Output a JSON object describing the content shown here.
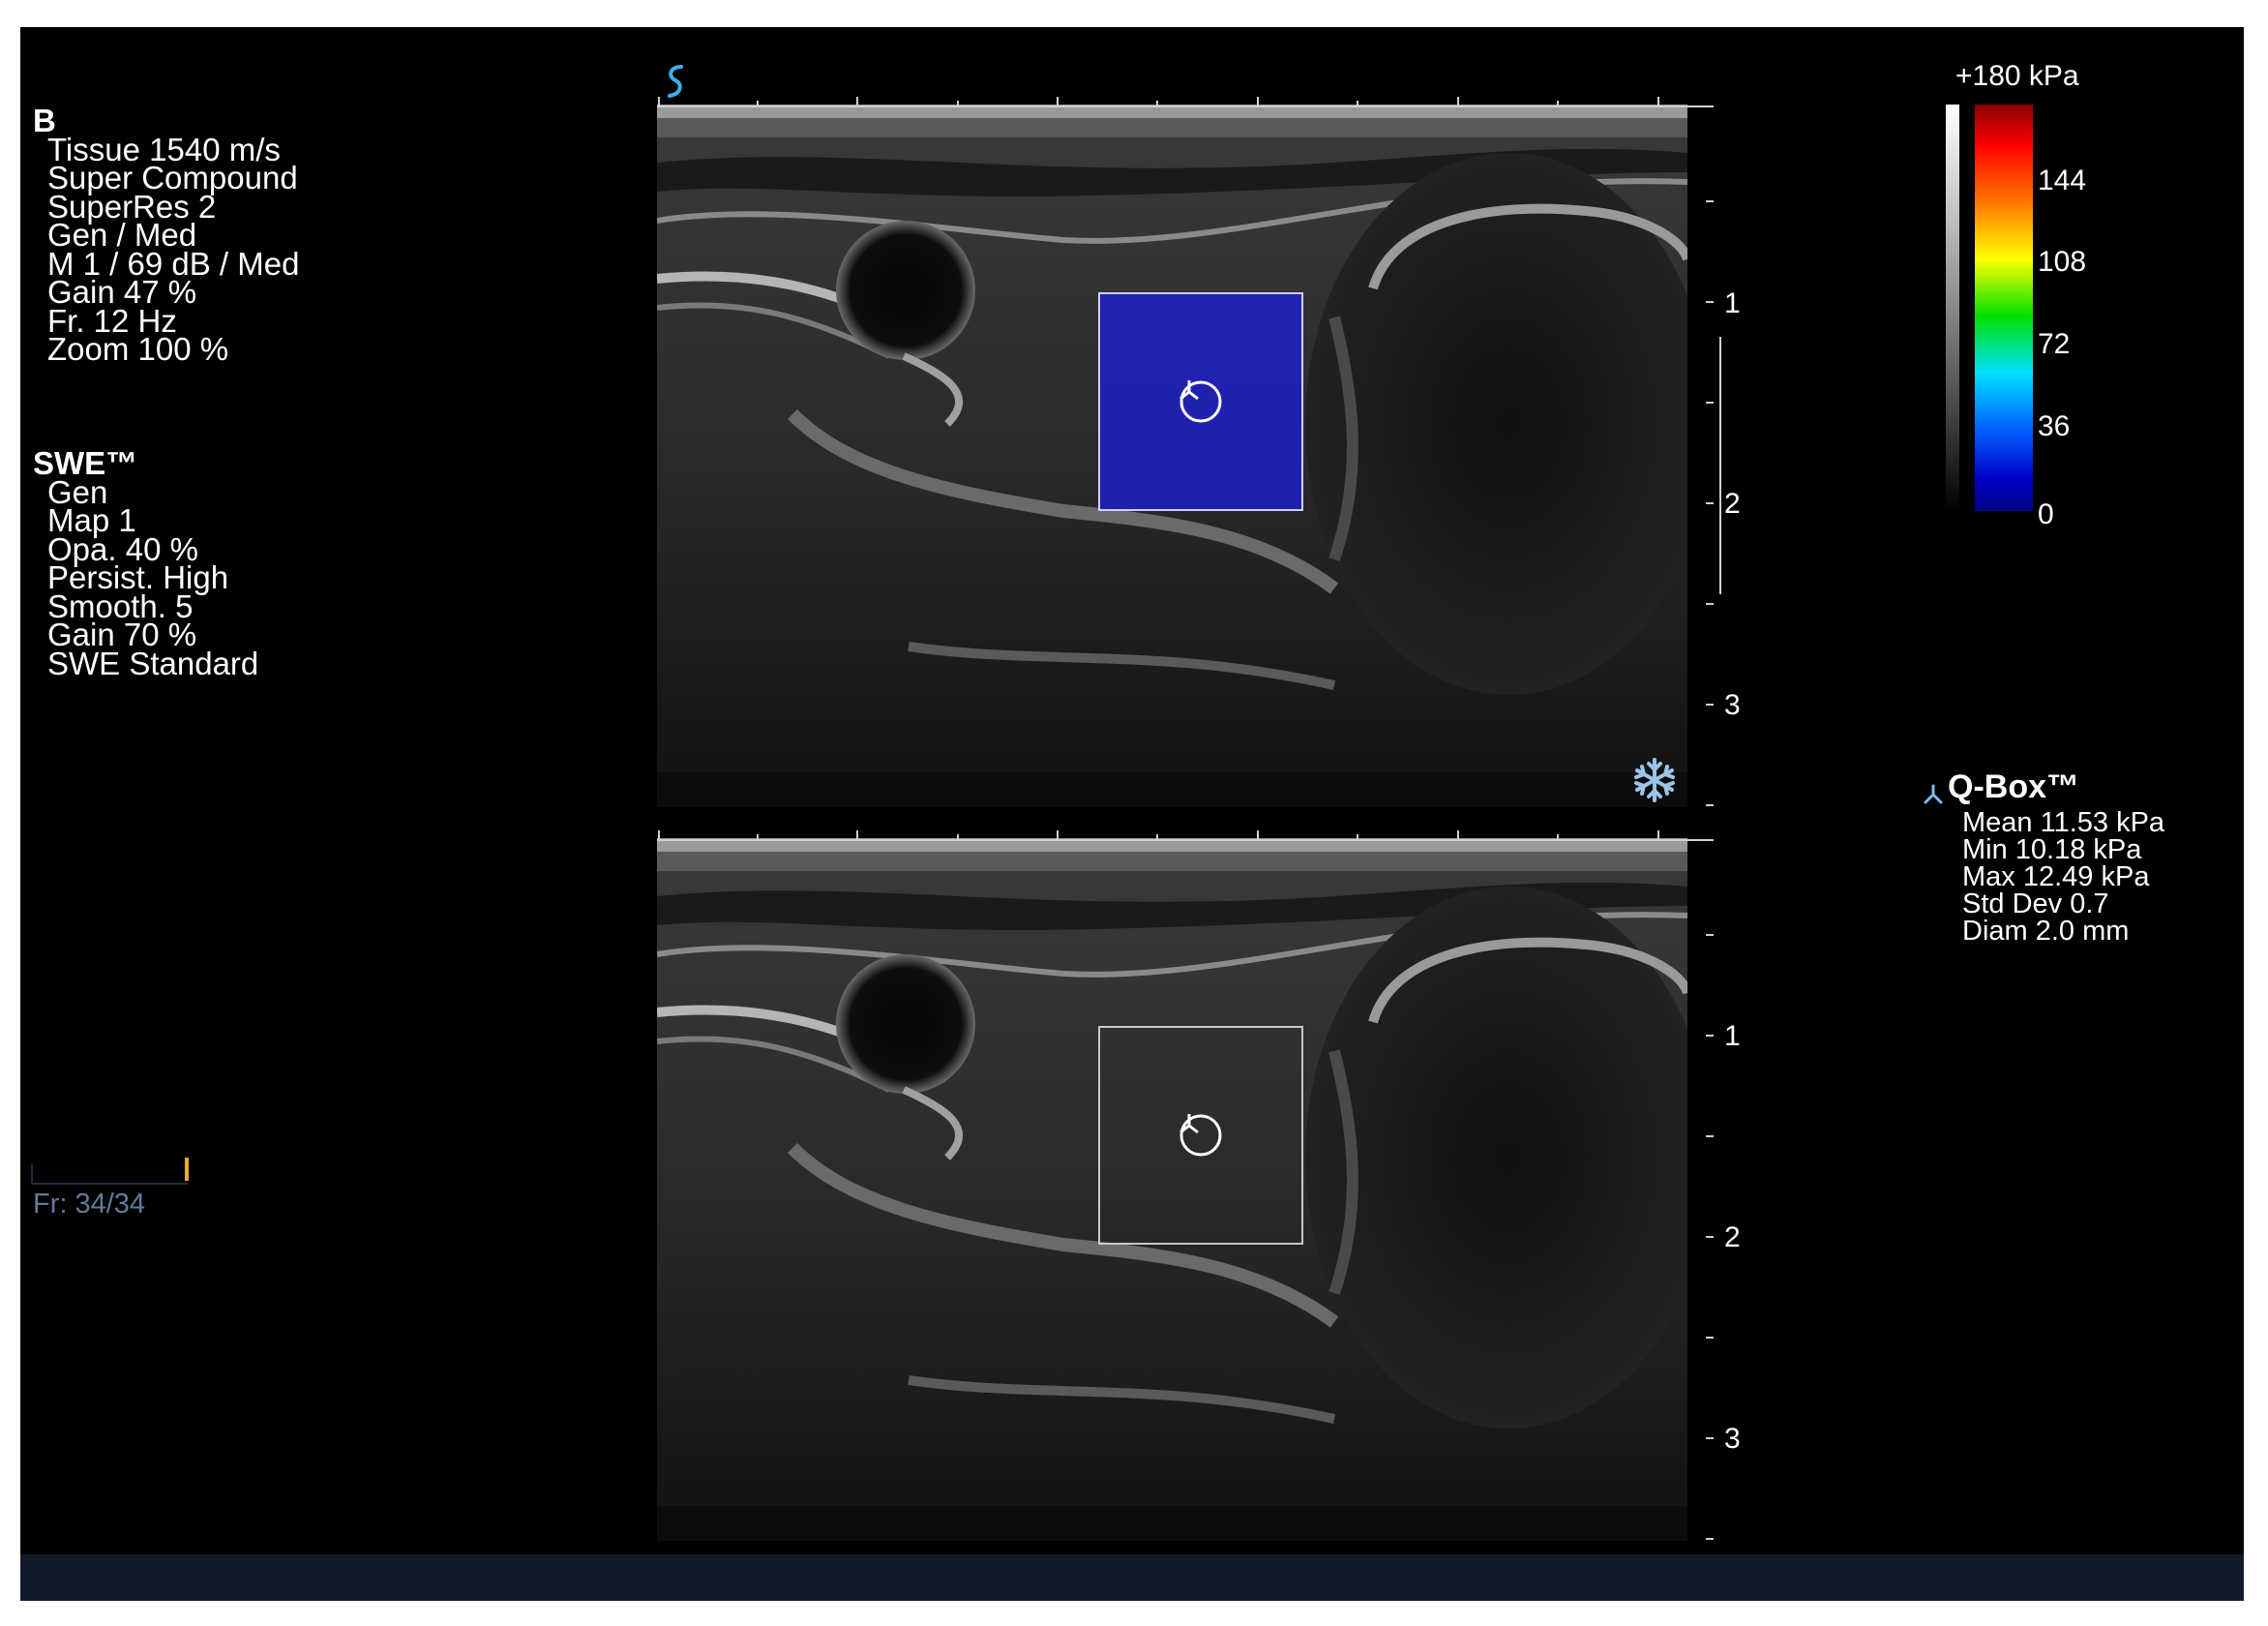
{
  "bmode": {
    "header": "B",
    "lines": [
      "Tissue 1540 m/s",
      "Super Compound",
      "SuperRes 2",
      "Gen / Med",
      "M 1 / 69 dB / Med",
      "Gain 47 %",
      "Fr. 12 Hz",
      "Zoom 100 %"
    ]
  },
  "swe": {
    "header": "SWE™",
    "lines": [
      "Gen",
      "Map 1",
      "Opa. 40 %",
      "Persist. High",
      "Smooth. 5",
      "Gain 70 %",
      "SWE Standard"
    ]
  },
  "cine": {
    "frame_label": "Fr: 34/34",
    "position": 1.0
  },
  "depth_scale": {
    "labels": [
      "1",
      "2",
      "3"
    ]
  },
  "color_scale": {
    "max_label": "+180 kPa",
    "ticks": [
      "144",
      "108",
      "72",
      "36",
      "0"
    ]
  },
  "qbox": {
    "title": "Q-Box™",
    "stats": [
      "Mean 11.53 kPa",
      "Min 10.18 kPa",
      "Max 12.49 kPa",
      "Std Dev 0.7",
      "Diam 2.0 mm"
    ]
  },
  "icons": {
    "probe": "probe-orientation-icon",
    "freeze": "freeze-snowflake-icon",
    "qbox": "qbox-marker-icon"
  },
  "colors": {
    "swe_overlay": "#2020c8",
    "probe_icon": "#3ab0e8",
    "freeze_icon": "#9cc4e8",
    "frame_counter": "#5f7b99",
    "cine_marker": "#e8a82a",
    "status_bar": "#101b27"
  }
}
